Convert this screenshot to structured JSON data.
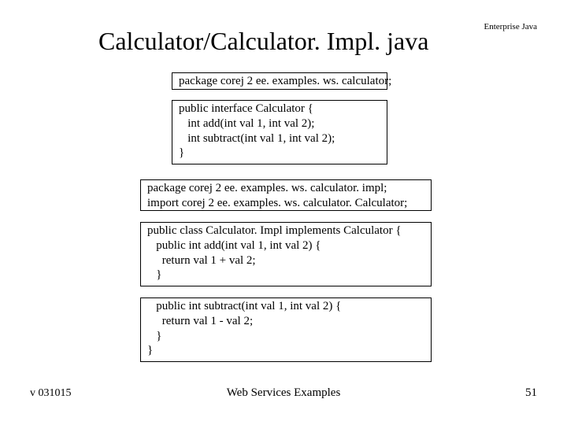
{
  "header_label": "Enterprise\nJava",
  "title": "Calculator/Calculator. Impl. java",
  "box1": "package corej 2 ee. examples. ws. calculator;",
  "box2": "public interface Calculator {\n   int add(int val 1, int val 2);\n   int subtract(int val 1, int val 2);\n}",
  "box3": "package corej 2 ee. examples. ws. calculator. impl;\nimport corej 2 ee. examples. ws. calculator. Calculator;",
  "box4": "public class Calculator. Impl implements Calculator {\n   public int add(int val 1, int val 2) {\n     return val 1 + val 2;\n   }",
  "box5": "   public int subtract(int val 1, int val 2) {\n     return val 1 - val 2;\n   }\n}",
  "footer_left": "v 031015",
  "footer_center": "Web Services Examples",
  "footer_right": "51"
}
